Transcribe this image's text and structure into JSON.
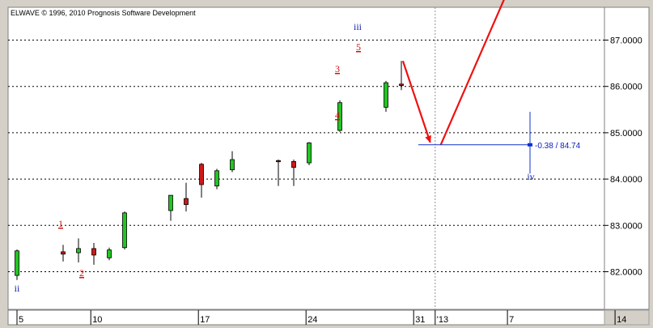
{
  "chart_data": {
    "type": "candlestick",
    "copyright": "ELWAVE © 1996, 2010 Prognosis Software Development",
    "x_ticks": [
      "5",
      "10",
      "17",
      "24",
      "31",
      "'13",
      "7",
      "14"
    ],
    "y_ticks": [
      "82.0000",
      "83.0000",
      "84.0000",
      "85.0000",
      "86.0000",
      "87.0000"
    ],
    "ylim": [
      81.6,
      87.65
    ],
    "candles": [
      {
        "day": 5,
        "o": 81.92,
        "h": 82.48,
        "l": 81.82,
        "c": 82.45
      },
      {
        "day": 8,
        "o": 82.43,
        "h": 82.58,
        "l": 82.22,
        "c": 82.38
      },
      {
        "day": 9,
        "o": 82.41,
        "h": 82.72,
        "l": 82.2,
        "c": 82.5
      },
      {
        "day": 10,
        "o": 82.5,
        "h": 82.62,
        "l": 82.15,
        "c": 82.36
      },
      {
        "day": 11,
        "o": 82.3,
        "h": 82.52,
        "l": 82.25,
        "c": 82.47
      },
      {
        "day": 12,
        "o": 82.52,
        "h": 83.3,
        "l": 82.48,
        "c": 83.27
      },
      {
        "day": 15,
        "o": 83.32,
        "h": 83.65,
        "l": 83.1,
        "c": 83.65
      },
      {
        "day": 16,
        "o": 83.58,
        "h": 83.92,
        "l": 83.3,
        "c": 83.45
      },
      {
        "day": 17,
        "o": 84.32,
        "h": 84.35,
        "l": 83.6,
        "c": 83.88
      },
      {
        "day": 18,
        "o": 83.85,
        "h": 84.22,
        "l": 83.78,
        "c": 84.18
      },
      {
        "day": 19,
        "o": 84.2,
        "h": 84.6,
        "l": 84.15,
        "c": 84.42
      },
      {
        "day": 22,
        "o": 84.4,
        "h": 84.42,
        "l": 83.85,
        "c": 84.38
      },
      {
        "day": 23,
        "o": 84.38,
        "h": 84.42,
        "l": 83.85,
        "c": 84.25
      },
      {
        "day": 24,
        "o": 84.35,
        "h": 84.8,
        "l": 84.3,
        "c": 84.78
      },
      {
        "day": 26,
        "o": 85.05,
        "h": 85.7,
        "l": 85.02,
        "c": 85.65
      },
      {
        "day": 29,
        "o": 85.55,
        "h": 86.12,
        "l": 85.45,
        "c": 86.08
      },
      {
        "day": 30,
        "o": 86.05,
        "h": 86.55,
        "l": 85.92,
        "c": 86.02
      }
    ],
    "wave_labels": [
      {
        "text": "ii",
        "color": "blue",
        "day": 5,
        "y": 81.58
      },
      {
        "text": "1",
        "color": "red",
        "day": 9,
        "y": 82.95
      },
      {
        "text": "2",
        "color": "red",
        "day": 10,
        "y": 81.95
      },
      {
        "text": "3",
        "color": "red",
        "day": 29,
        "y": 86.3
      },
      {
        "text": "4",
        "color": "red",
        "day": 29,
        "y": 85.25
      },
      {
        "text": "5",
        "color": "red",
        "day": 30,
        "y": 86.8
      },
      {
        "text": "iii",
        "color": "blue",
        "day": 30,
        "y": 87.35
      },
      {
        "text": "iv",
        "color": "blue",
        "day": 9.5,
        "y": 83.92
      }
    ],
    "projection": [
      {
        "day": 30.1,
        "y": 86.55
      },
      {
        "day": 32.3,
        "y": 84.74
      },
      {
        "day": 37.5,
        "y": 88.5
      }
    ],
    "target": {
      "label": "-0.38 / 84.74",
      "value": 84.74,
      "start_day": 31.7,
      "end_day": 9.5,
      "high": 85.45,
      "low": 84.12
    },
    "current_day": 32.2
  }
}
